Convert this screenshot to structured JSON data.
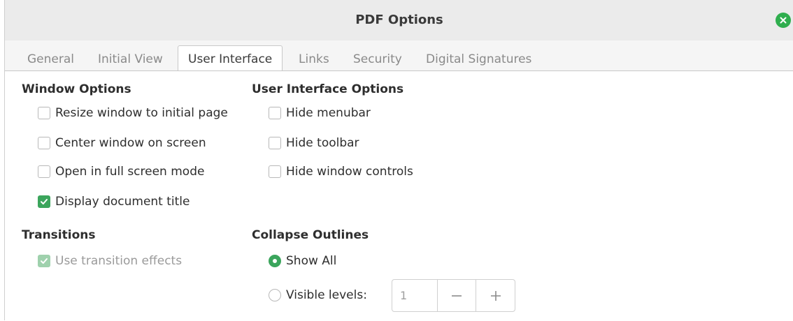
{
  "window": {
    "title": "PDF Options",
    "close_icon": "close-icon"
  },
  "tabs": [
    {
      "label": "General",
      "active": false
    },
    {
      "label": "Initial View",
      "active": false
    },
    {
      "label": "User Interface",
      "active": true
    },
    {
      "label": "Links",
      "active": false
    },
    {
      "label": "Security",
      "active": false
    },
    {
      "label": "Digital Signatures",
      "active": false
    }
  ],
  "window_options": {
    "title": "Window Options",
    "items": [
      {
        "label": "Resize window to initial page",
        "checked": false
      },
      {
        "label": "Center window on screen",
        "checked": false
      },
      {
        "label": "Open in full screen mode",
        "checked": false
      },
      {
        "label": "Display document title",
        "checked": true
      }
    ]
  },
  "ui_options": {
    "title": "User Interface Options",
    "items": [
      {
        "label": "Hide menubar",
        "checked": false
      },
      {
        "label": "Hide toolbar",
        "checked": false
      },
      {
        "label": "Hide window controls",
        "checked": false
      }
    ]
  },
  "transitions": {
    "title": "Transitions",
    "use_effects": {
      "label": "Use transition effects",
      "checked": true,
      "disabled": true
    }
  },
  "collapse_outlines": {
    "title": "Collapse Outlines",
    "show_all": {
      "label": "Show All",
      "selected": true
    },
    "visible_levels": {
      "label": "Visible levels:",
      "selected": false,
      "value": "1"
    }
  },
  "colors": {
    "accent": "#3ba55c",
    "close": "#2fae4e"
  }
}
